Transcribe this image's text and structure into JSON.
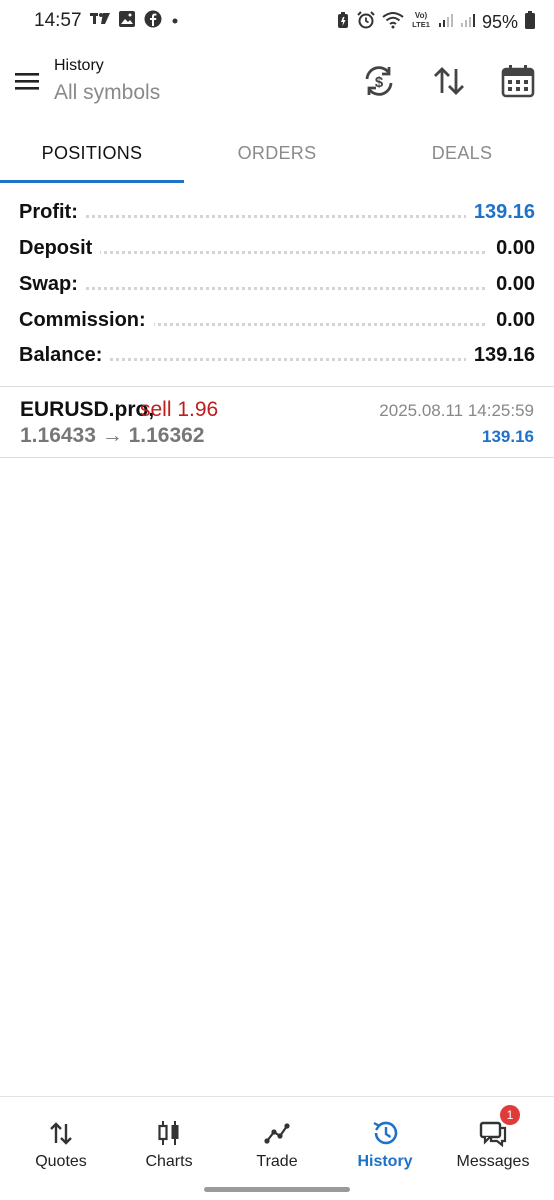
{
  "status_bar": {
    "time": "14:57",
    "battery": "95%",
    "left_icons": [
      "tradingview-icon",
      "image-icon",
      "facebook-icon",
      "dot-icon"
    ],
    "right_icons": [
      "battery-saver-icon",
      "alarm-icon",
      "wifi-icon",
      "volte-icon",
      "signal-icon",
      "signal-icon",
      "battery-icon"
    ]
  },
  "header": {
    "title": "History",
    "subtitle": "All symbols"
  },
  "tabs": [
    {
      "label": "POSITIONS",
      "active": true
    },
    {
      "label": "ORDERS",
      "active": false
    },
    {
      "label": "DEALS",
      "active": false
    }
  ],
  "summary": [
    {
      "label": "Profit:",
      "value": "139.16"
    },
    {
      "label": "Deposit",
      "value": "0.00"
    },
    {
      "label": "Swap:",
      "value": "0.00"
    },
    {
      "label": "Commission:",
      "value": "0.00"
    },
    {
      "label": "Balance:",
      "value": "139.16"
    }
  ],
  "positions": [
    {
      "symbol": "EURUSD.pro,",
      "side": "sell 1.96",
      "prices": "1.16433 → 1.16362",
      "time": "2025.08.11 14:25:59",
      "profit": "139.16"
    }
  ],
  "bottom_nav": [
    {
      "label": "Quotes",
      "icon": "sort-arrows-icon",
      "active": false
    },
    {
      "label": "Charts",
      "icon": "candlestick-icon",
      "active": false
    },
    {
      "label": "Trade",
      "icon": "trend-line-icon",
      "active": false
    },
    {
      "label": "History",
      "icon": "history-icon",
      "active": true
    },
    {
      "label": "Messages",
      "icon": "chat-icon",
      "active": false,
      "badge": "1"
    }
  ],
  "colors": {
    "accent": "#1e73c8",
    "sell": "#c01c1c",
    "badge": "#e03b3b"
  }
}
